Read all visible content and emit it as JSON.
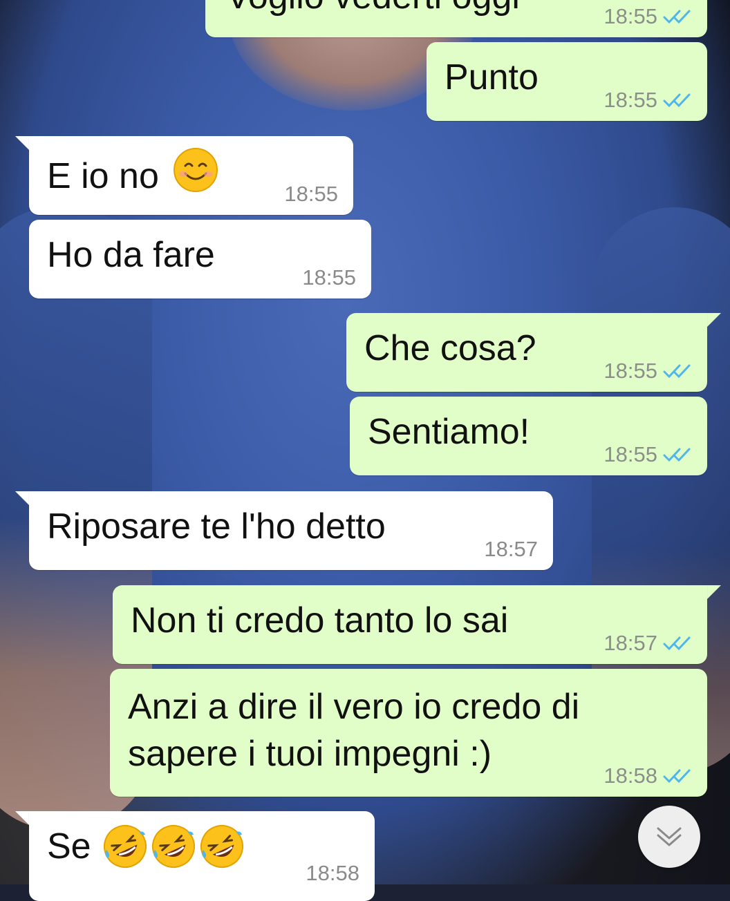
{
  "messages": [
    {
      "id": "m0",
      "direction": "out",
      "text": "Voglio vederti oggi",
      "time": "18:55",
      "status": "read"
    },
    {
      "id": "m1",
      "direction": "out",
      "text": "Punto",
      "time": "18:55",
      "status": "read"
    },
    {
      "id": "m2",
      "direction": "in",
      "text": "E io no",
      "emoji": "smiling-face-icon",
      "time": "18:55"
    },
    {
      "id": "m3",
      "direction": "in",
      "text": "Ho da fare",
      "time": "18:55"
    },
    {
      "id": "m4",
      "direction": "out",
      "text": "Che cosa?",
      "time": "18:55",
      "status": "read"
    },
    {
      "id": "m5",
      "direction": "out",
      "text": "Sentiamo!",
      "time": "18:55",
      "status": "read"
    },
    {
      "id": "m6",
      "direction": "in",
      "text": "Riposare te l'ho detto",
      "time": "18:57"
    },
    {
      "id": "m7",
      "direction": "out",
      "text": "Non ti credo tanto lo sai",
      "time": "18:57",
      "status": "read"
    },
    {
      "id": "m8",
      "direction": "out",
      "text_line1": "Anzi a dire il vero io credo di",
      "text_line2": "sapere i tuoi impegni :)",
      "time": "18:58",
      "status": "read"
    },
    {
      "id": "m9",
      "direction": "in",
      "text": "Se",
      "emoji": "rolling-on-floor-laughing-icon x3",
      "time": "18:58"
    }
  ],
  "colors": {
    "outgoing_bubble": "#e2fec8",
    "incoming_bubble": "#ffffff",
    "read_tick": "#4fb6ec",
    "timestamp": "#8a8f8a"
  },
  "scroll_button_icon": "double-chevron-down-icon"
}
